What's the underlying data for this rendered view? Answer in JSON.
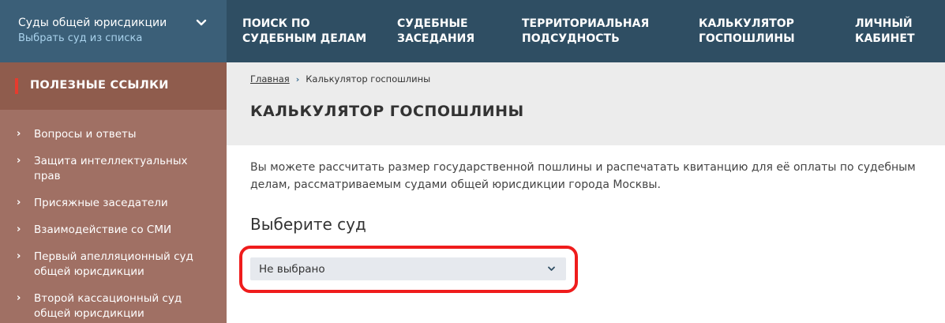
{
  "court_selector": {
    "title": "Суды общей юрисдикции",
    "subtitle": "Выбрать суд из списка",
    "icon": "chevron-down-icon"
  },
  "nav": [
    {
      "line1": "Поиск по",
      "line2": "судебным делам"
    },
    {
      "line1": "Судебные",
      "line2": "заседания"
    },
    {
      "line1": "Территориальная",
      "line2": "подсудность"
    },
    {
      "line1": "Калькулятор",
      "line2": "госпошлины"
    },
    {
      "line1": "Личный",
      "line2": "кабинет"
    }
  ],
  "sidebar": {
    "title": "Полезные ссылки",
    "arrow": "›",
    "items": [
      {
        "label": "Вопросы и ответы"
      },
      {
        "label": "Защита интеллектуальных прав"
      },
      {
        "label": "Присяжные заседатели"
      },
      {
        "label": "Взаимодействие со СМИ"
      },
      {
        "label": "Первый апелляционный суд общей юрисдикции"
      },
      {
        "label": "Второй кассационный суд общей юрисдикции"
      }
    ]
  },
  "breadcrumb": {
    "home": "Главная",
    "separator": "›",
    "current": "Калькулятор госпошлины"
  },
  "page": {
    "title": "Калькулятор госпошлины",
    "intro": "Вы можете рассчитать размер государственной пошлины и распечатать квитанцию для её оплаты по судебным делам, рассматриваемым судами общей юрисдикции города Москвы.",
    "choose_label": "Выберите суд"
  },
  "court_dropdown": {
    "selected": "Не выбрано",
    "icon": "chevron-down-icon"
  },
  "colors": {
    "topbar": "#2f4e63",
    "court_selector_bg": "#3b5f78",
    "sidebar_bg": "#a07064",
    "sidebar_head_bg": "#8f5c4d",
    "accent_red": "#e63b2e",
    "highlight_red": "#ef1c1c"
  }
}
